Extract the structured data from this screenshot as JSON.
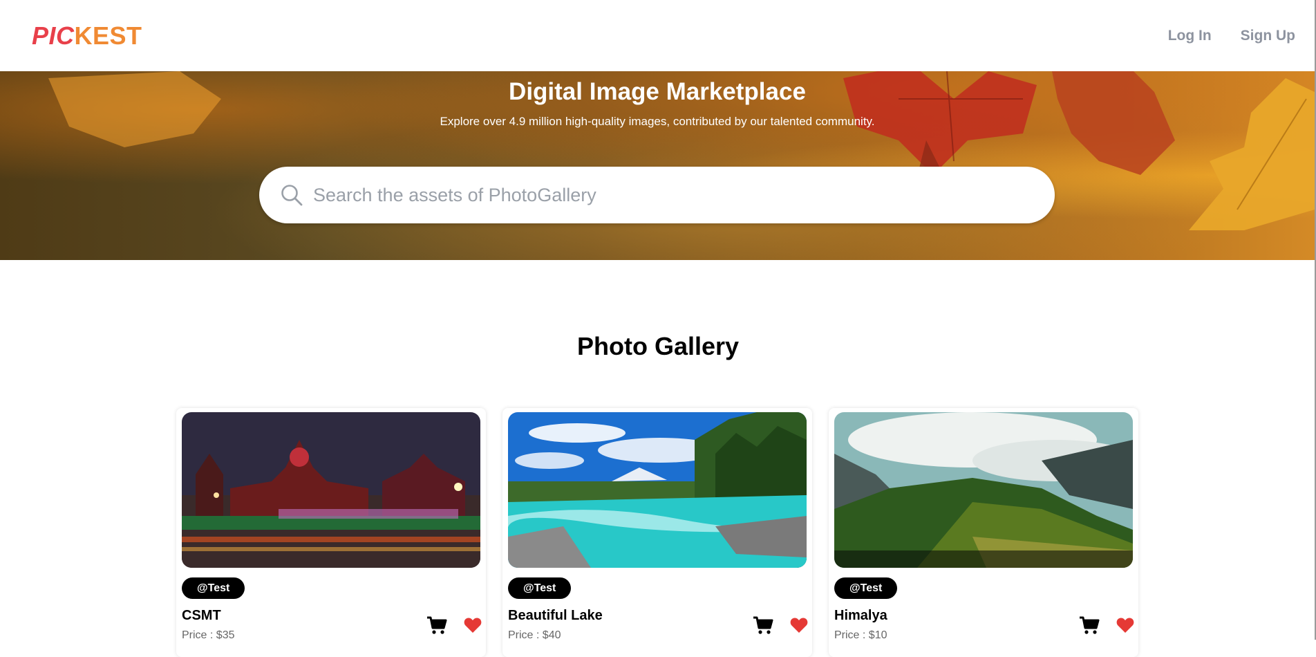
{
  "header": {
    "logo_part1": "PIC",
    "logo_part2": "KEST",
    "login_label": "Log In",
    "signup_label": "Sign Up"
  },
  "hero": {
    "title": "Digital Image Marketplace",
    "subtitle": "Explore over 4.9 million high-quality images, contributed by our talented community.",
    "search_placeholder": "Search the assets of PhotoGallery"
  },
  "gallery": {
    "title": "Photo Gallery",
    "cards": [
      {
        "tag": "@Test",
        "title": "CSMT",
        "price": "Price : $35"
      },
      {
        "tag": "@Test",
        "title": "Beautiful Lake",
        "price": "Price : $40"
      },
      {
        "tag": "@Test",
        "title": "Himalya",
        "price": "Price : $10"
      }
    ]
  },
  "colors": {
    "logo_red": "#e8404a",
    "logo_orange": "#f08a33",
    "nav_gray": "#8d939f",
    "heart_red": "#e53935"
  },
  "icons": [
    "search-icon",
    "cart-icon",
    "heart-icon"
  ]
}
